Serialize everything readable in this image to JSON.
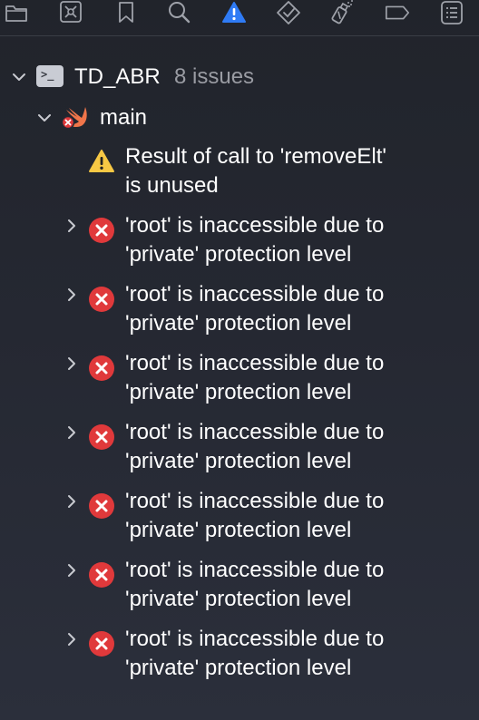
{
  "toolbar": {
    "icons": [
      "folder-icon",
      "source-control-icon",
      "bookmark-icon",
      "search-icon",
      "issue-warning-icon",
      "test-diamond-icon",
      "debug-spray-icon",
      "breakpoint-icon",
      "report-list-icon"
    ],
    "active_icon": "issue-warning-icon",
    "active_color": "#2f7bf5"
  },
  "project": {
    "name": "TD_ABR",
    "issue_count": "8 issues"
  },
  "file": {
    "name": "main"
  },
  "issues": [
    {
      "type": "warning",
      "line1": "Result of call to 'removeElt'",
      "line2": "is unused",
      "expandable": false
    },
    {
      "type": "error",
      "line1": "'root' is inaccessible due to",
      "line2": "'private' protection level",
      "expandable": true
    },
    {
      "type": "error",
      "line1": "'root' is inaccessible due to",
      "line2": "'private' protection level",
      "expandable": true
    },
    {
      "type": "error",
      "line1": "'root' is inaccessible due to",
      "line2": "'private' protection level",
      "expandable": true
    },
    {
      "type": "error",
      "line1": "'root' is inaccessible due to",
      "line2": "'private' protection level",
      "expandable": true
    },
    {
      "type": "error",
      "line1": "'root' is inaccessible due to",
      "line2": "'private' protection level",
      "expandable": true
    },
    {
      "type": "error",
      "line1": "'root' is inaccessible due to",
      "line2": "'private' protection level",
      "expandable": true
    },
    {
      "type": "error",
      "line1": "'root' is inaccessible due to",
      "line2": "'private' protection level",
      "expandable": true
    }
  ],
  "colors": {
    "error": "#e0393b",
    "warning": "#f7c844",
    "swift": "#f0754a"
  }
}
